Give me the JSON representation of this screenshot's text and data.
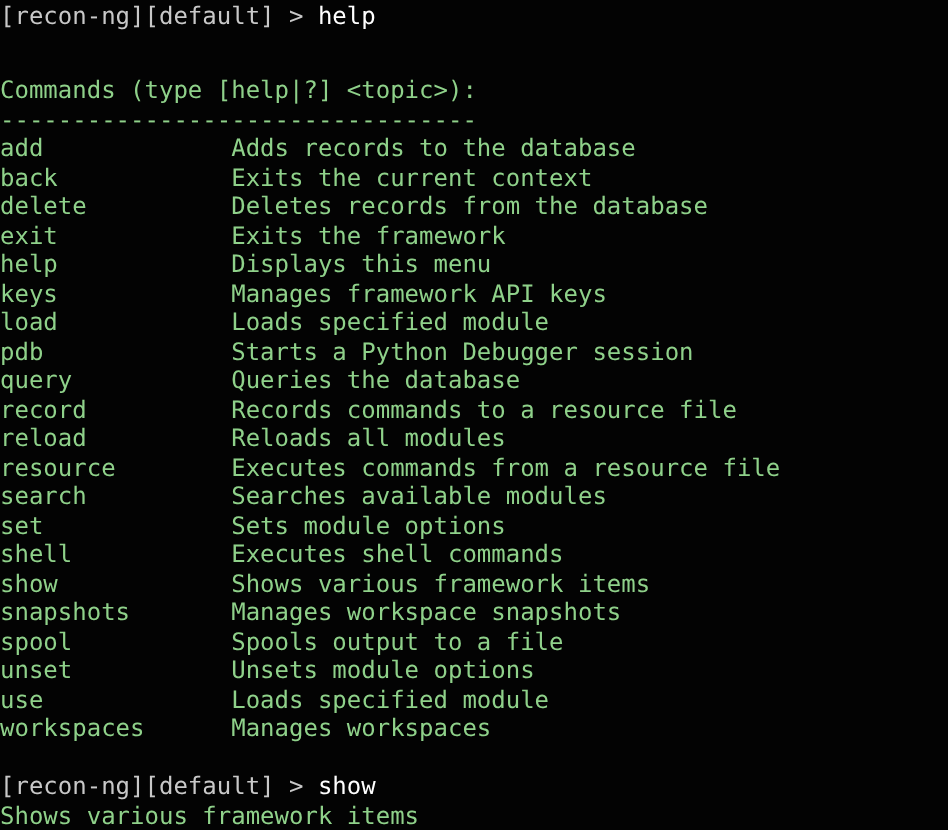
{
  "prompt_1": {
    "prompt": "[recon-ng][default] >",
    "command": "help"
  },
  "commands_header": "Commands (type [help|?] <topic>):",
  "header_rule": "---------------------------------",
  "commands": [
    {
      "name": "add",
      "description": "Adds records to the database"
    },
    {
      "name": "back",
      "description": "Exits the current context"
    },
    {
      "name": "delete",
      "description": "Deletes records from the database"
    },
    {
      "name": "exit",
      "description": "Exits the framework"
    },
    {
      "name": "help",
      "description": "Displays this menu"
    },
    {
      "name": "keys",
      "description": "Manages framework API keys"
    },
    {
      "name": "load",
      "description": "Loads specified module"
    },
    {
      "name": "pdb",
      "description": "Starts a Python Debugger session"
    },
    {
      "name": "query",
      "description": "Queries the database"
    },
    {
      "name": "record",
      "description": "Records commands to a resource file"
    },
    {
      "name": "reload",
      "description": "Reloads all modules"
    },
    {
      "name": "resource",
      "description": "Executes commands from a resource file"
    },
    {
      "name": "search",
      "description": "Searches available modules"
    },
    {
      "name": "set",
      "description": "Sets module options"
    },
    {
      "name": "shell",
      "description": "Executes shell commands"
    },
    {
      "name": "show",
      "description": "Shows various framework items"
    },
    {
      "name": "snapshots",
      "description": "Manages workspace snapshots"
    },
    {
      "name": "spool",
      "description": "Spools output to a file"
    },
    {
      "name": "unset",
      "description": "Unsets module options"
    },
    {
      "name": "use",
      "description": "Loads specified module"
    },
    {
      "name": "workspaces",
      "description": "Manages workspaces"
    }
  ],
  "prompt_2": {
    "prompt": "[recon-ng][default] >",
    "command": "show"
  },
  "output": "Shows various framework items"
}
